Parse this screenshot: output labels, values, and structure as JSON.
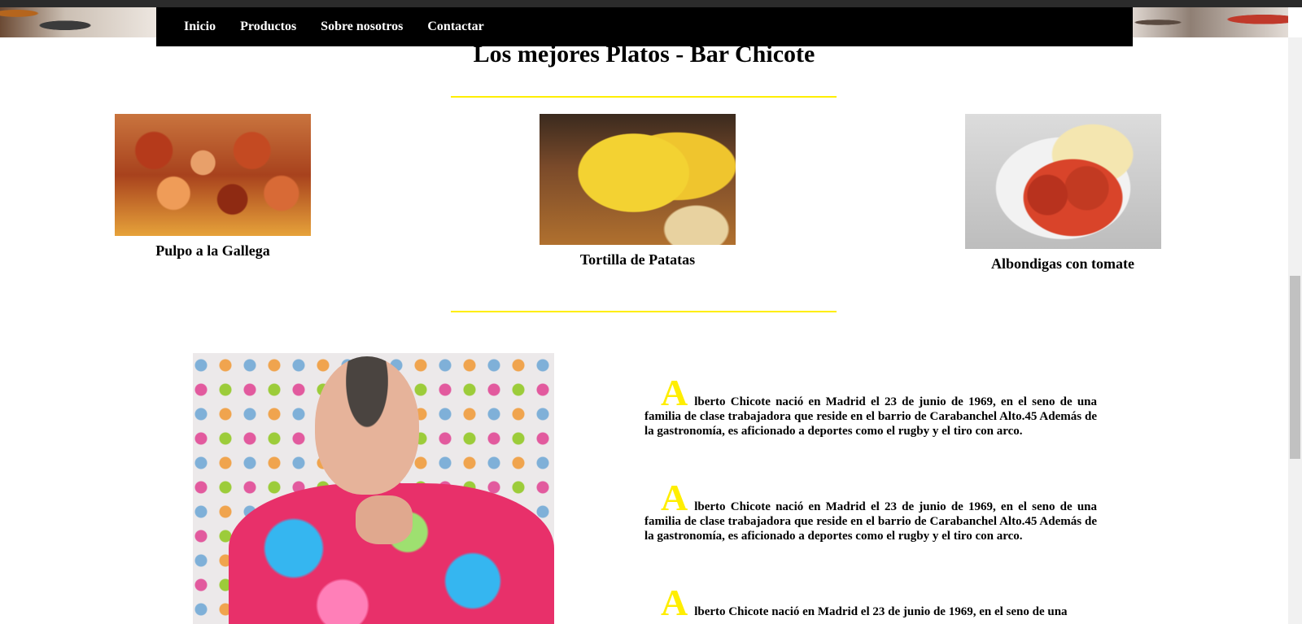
{
  "nav": {
    "items": [
      {
        "label": "Inicio"
      },
      {
        "label": "Productos"
      },
      {
        "label": "Sobre nosotros"
      },
      {
        "label": "Contactar"
      }
    ]
  },
  "dishes_section": {
    "title": "Los mejores Platos - Bar Chicote",
    "dishes": [
      {
        "label": "Pulpo a la Gallega"
      },
      {
        "label": "Tortilla de Patatas"
      },
      {
        "label": "Albondigas con tomate"
      }
    ]
  },
  "bio": {
    "paragraphs": [
      {
        "initial": "A",
        "text": "lberto Chicote nació en Madrid el 23 de junio de 1969, en el seno de una familia de clase trabajadora que reside en el barrio de Carabanchel Alto.45 Además de la gastronomía, es aficionado a deportes como el rugby y el tiro con arco."
      },
      {
        "initial": "A",
        "text": "lberto Chicote nació en Madrid el 23 de junio de 1969, en el seno de una familia de clase trabajadora que reside en el barrio de Carabanchel Alto.45 Además de la gastronomía, es aficionado a deportes como el rugby y el tiro con arco."
      },
      {
        "initial": "A",
        "text": "lberto Chicote nació en Madrid el 23 de junio de 1969, en el seno de una"
      }
    ]
  },
  "colors": {
    "accent": "#ffee00",
    "nav_bg": "#000000",
    "nav_text": "#ffffff"
  }
}
